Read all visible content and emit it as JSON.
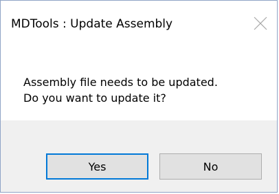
{
  "window": {
    "title": "MDTools : Update Assembly",
    "close_icon": "close-icon"
  },
  "message": {
    "line1": "Assembly file needs to be updated.",
    "line2": "Do you want to update it?"
  },
  "buttons": {
    "yes_label": "Yes",
    "no_label": "No",
    "default_border_color": "#0078d7"
  }
}
